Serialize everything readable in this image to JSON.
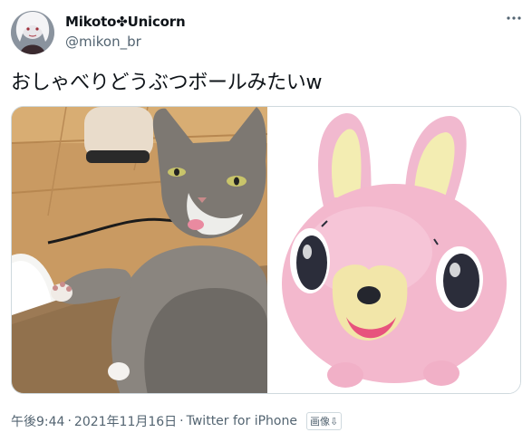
{
  "author": {
    "display_name": "Mikoto✤Unicorn",
    "handle": "@mikon_br",
    "avatar_icon": "avatar-icon"
  },
  "tweet": {
    "text": "おしゃべりどうぶつボールみたいw"
  },
  "media": {
    "photos": [
      {
        "subject": "cat"
      },
      {
        "subject": "pink-rabbit-toy"
      }
    ]
  },
  "meta": {
    "time": "午後9:44",
    "separator": "·",
    "date": "2021年11月16日",
    "source": "Twitter for iPhone",
    "alt_badge": "画像⇩"
  },
  "colors": {
    "text": "#0f1419",
    "secondary": "#536471",
    "border": "#cfd9de"
  }
}
